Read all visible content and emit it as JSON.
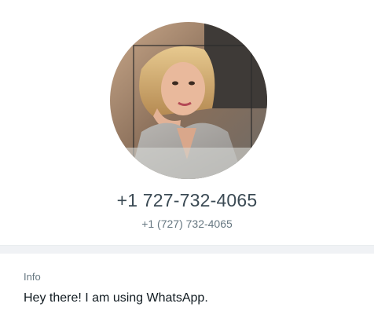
{
  "profile": {
    "avatar_icon": "contact-photo",
    "phone_display": "+1 727-732-4065",
    "phone_formatted": "+1 (727) 732-4065"
  },
  "info": {
    "label": "Info",
    "about": "Hey there! I am using WhatsApp."
  },
  "colors": {
    "primary_text": "#3b4a54",
    "secondary_text": "#667781",
    "divider": "#f0f2f5"
  }
}
